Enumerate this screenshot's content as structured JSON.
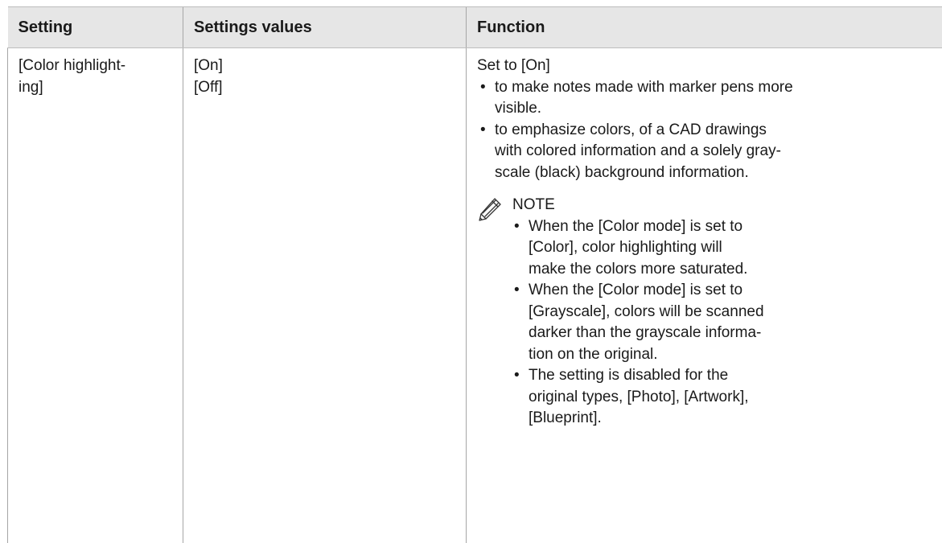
{
  "table": {
    "headers": {
      "setting": "Setting",
      "values": "Settings values",
      "function": "Function"
    },
    "row": {
      "setting_lines": [
        "[Color highlight-",
        "ing]"
      ],
      "values": [
        "[On]",
        "[Off]"
      ],
      "function_intro": "Set to [On]",
      "function_bullets": [
        [
          "to make notes made with marker pens more",
          "visible."
        ],
        [
          "to emphasize colors, of a CAD drawings",
          "with colored information and a solely gray-",
          "scale (black) background information."
        ]
      ],
      "note": {
        "icon": "pencil-icon",
        "title": "NOTE",
        "bullets": [
          [
            "When the [Color mode] is set to",
            "[Color], color highlighting will",
            "make the colors more saturated."
          ],
          [
            "When the [Color mode] is set to",
            "[Grayscale], colors will be scanned",
            "darker than the grayscale informa-",
            "tion on the original."
          ],
          [
            "The setting is disabled for the",
            "original types, [Photo], [Artwork],",
            "[Blueprint]."
          ]
        ]
      }
    }
  },
  "bullet_glyph": "•"
}
